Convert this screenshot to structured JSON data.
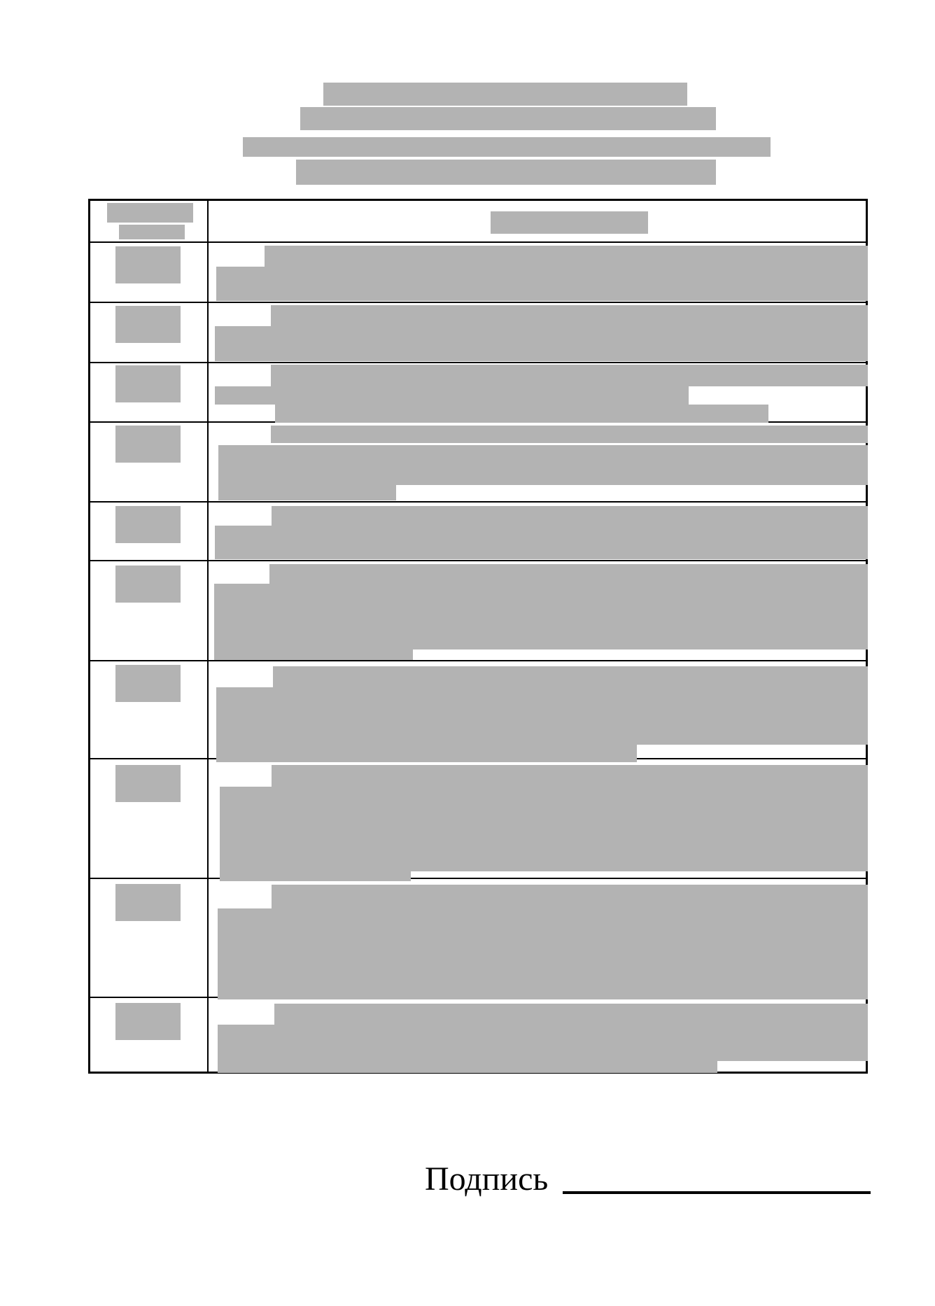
{
  "document": {
    "redaction_color": "#b3b3b3",
    "title_lines": [
      "",
      "",
      "",
      ""
    ],
    "table": {
      "header": {
        "col_left": "",
        "col_right": ""
      },
      "rows": [
        {
          "number": "",
          "text": ""
        },
        {
          "number": "",
          "text": ""
        },
        {
          "number": "",
          "text": ""
        },
        {
          "number": "",
          "text": ""
        },
        {
          "number": "",
          "text": ""
        },
        {
          "number": "",
          "text": ""
        },
        {
          "number": "",
          "text": ""
        },
        {
          "number": "",
          "text": ""
        },
        {
          "number": "",
          "text": ""
        },
        {
          "number": "",
          "text": ""
        }
      ]
    },
    "signature": {
      "label": "Подпись"
    }
  }
}
